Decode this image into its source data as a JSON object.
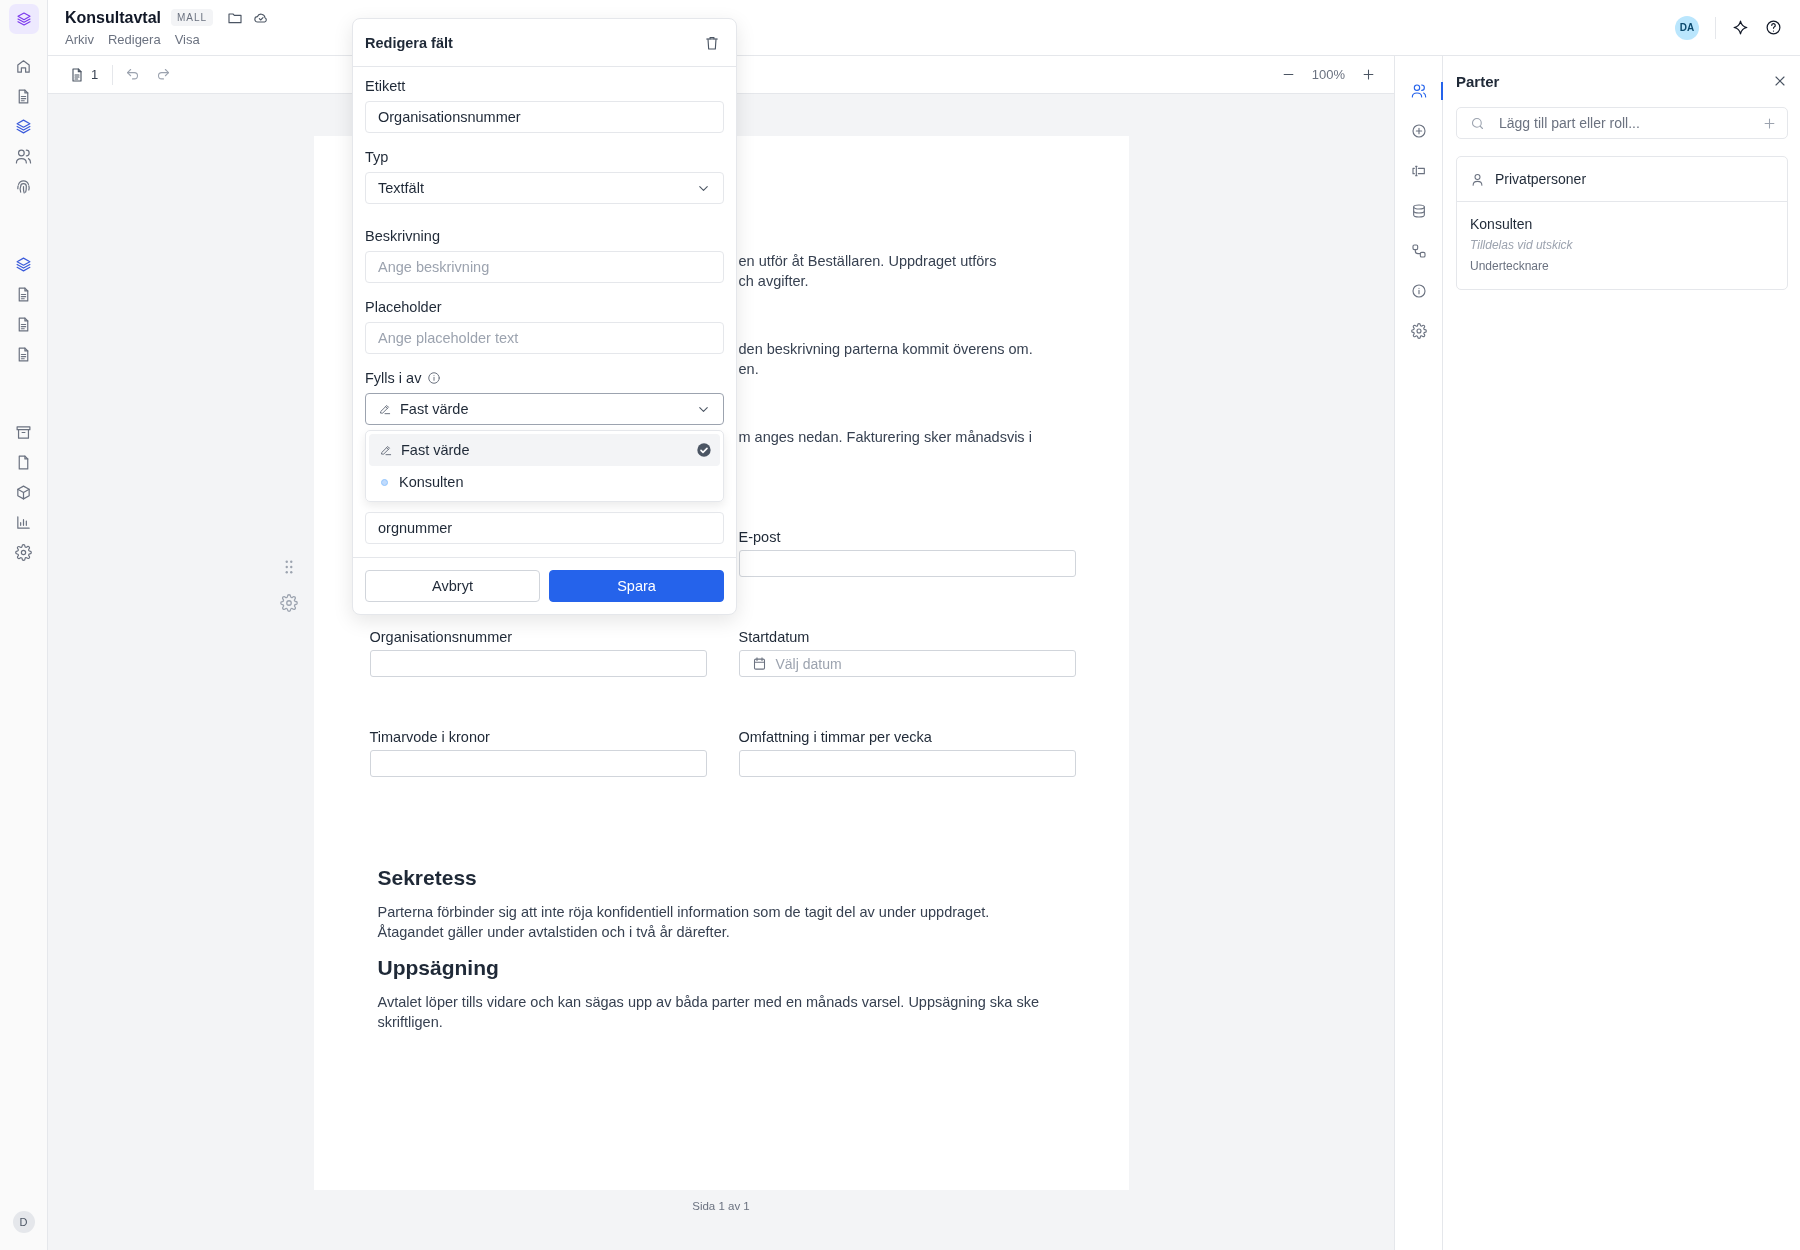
{
  "header": {
    "title": "Konsultavtal",
    "badge": "MALL",
    "menu": [
      "Arkiv",
      "Redigera",
      "Visa"
    ],
    "avatar": "DA"
  },
  "left_nav": {
    "groups": [
      {
        "items": [
          {
            "selected": false
          },
          {
            "selected": false
          },
          {
            "selected": true
          },
          {
            "selected": false
          },
          {
            "selected": false
          }
        ]
      },
      {
        "items": [
          {
            "selected": true
          },
          {
            "selected": false
          },
          {
            "selected": false
          },
          {
            "selected": false
          }
        ]
      },
      {
        "items": [
          {
            "selected": false
          },
          {
            "selected": false
          },
          {
            "selected": false
          },
          {
            "selected": false
          },
          {
            "selected": false
          }
        ]
      }
    ],
    "user_avatar": "D"
  },
  "toolbar": {
    "page_count": "1",
    "zoom": "100%"
  },
  "editor": {
    "title": "Redigera fält",
    "fields": [
      {
        "kind": "text",
        "label": "Etikett",
        "value": "Organisationsnummer"
      },
      {
        "kind": "select",
        "label": "Typ",
        "value": "Textfält"
      },
      {
        "kind": "text",
        "label": "Beskrivning",
        "placeholder": "Ange beskrivning"
      },
      {
        "kind": "text",
        "label": "Placeholder",
        "placeholder": "Ange placeholder text"
      },
      {
        "kind": "source",
        "label": "Fylls i av",
        "value": "Fast värde",
        "expanded": true,
        "options": [
          {
            "kind": "fixed",
            "label": "Fast värde",
            "selected": true
          },
          {
            "kind": "party",
            "label": "Konsulten",
            "selected": false
          }
        ]
      },
      {
        "kind": "text",
        "value": "orgnummer"
      }
    ],
    "cancel": "Avbryt",
    "save": "Spara"
  },
  "document": {
    "fragments": [
      [
        "en utför åt Beställaren. Uppdraget utförs",
        "ch avgifter."
      ],
      [
        "den beskrivning parterna kommit överens om.",
        "en."
      ],
      [
        "m anges nedan. Fakturering sker månadsvis i"
      ]
    ],
    "form_rows": [
      {
        "right": {
          "label": "E-post"
        }
      },
      {
        "left": {
          "label": "Organisationsnummer"
        },
        "right": {
          "label": "Startdatum",
          "kind": "date",
          "placeholder": "Välj datum"
        }
      },
      {
        "left": {
          "label": "Timarvode i kronor"
        },
        "right": {
          "label": "Omfattning i timmar per vecka"
        }
      }
    ],
    "sections": [
      {
        "heading": "Sekretess",
        "lines": [
          "Parterna förbinder sig att inte röja konfidentiell information som de tagit del av under uppdraget.",
          "Åtagandet gäller under avtalstiden och i två år därefter."
        ]
      },
      {
        "heading": "Uppsägning",
        "lines": [
          "Avtalet löper tills vidare och kan sägas upp av båda parter med en månads varsel. Uppsägning ska ske",
          "skriftligen."
        ]
      }
    ],
    "footer": "Sida 1 av 1"
  },
  "tool_rail": {
    "items": [
      {
        "selected": true
      },
      {
        "selected": false
      },
      {
        "selected": false
      },
      {
        "selected": false
      },
      {
        "selected": false
      },
      {
        "selected": false
      },
      {
        "selected": false
      }
    ]
  },
  "parties_panel": {
    "title": "Parter",
    "search_placeholder": "Lägg till part eller roll...",
    "group": "Privatpersoner",
    "parties": [
      {
        "name": "Konsulten",
        "assignment": "Tilldelas vid utskick",
        "role": "Undertecknare"
      }
    ]
  }
}
